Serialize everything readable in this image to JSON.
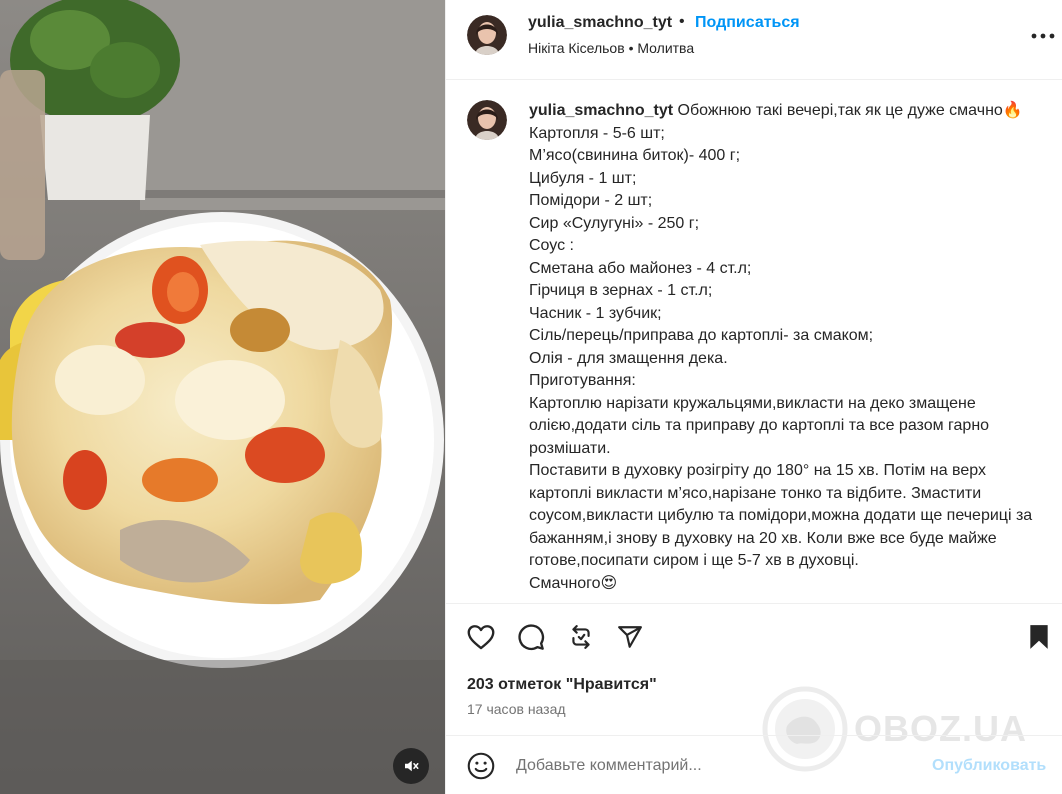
{
  "post": {
    "username": "yulia_smachno_tyt",
    "follow_label": "Подписаться",
    "separator": "•",
    "music_artist": "Нікіта Кісельов",
    "music_track": "Молитва",
    "caption_text": " Обожнюю такі вечері,так як це дуже смачно🔥\nКартопля - 5-6 шт;\nМ’ясо(свинина биток)- 400 г;\nЦибуля - 1 шт;\nПомідори - 2 шт;\nСир «Сулугуні» - 250 г;\nСоус :\nСметана або майонез - 4 ст.л;\nГірчиця в зернах - 1 ст.л;\nЧасник - 1 зубчик;\nСіль/перець/приправа до картоплі- за смаком;\nОлія - для змащення дека.\nПриготування:\nКартоплю нарізати кружальцями,викласти на деко змащене олією,додати сіль та приправу до картоплі та все разом гарно розмішати.\nПоставити в духовку розігріту до 180° на 15 хв. Потім на верх картоплі викласти м’ясо,нарізане тонко та відбите. Змастити соусом,викласти цибулю та помідори,можна додати ще печериці за бажанням,і знову в духовку на 20 хв. Коли вже все буде майже готове,посипати сиром і ще 5-7 хв в духовці.\nСмачного😍",
    "likes_label": "203 отметок \"Нравится\"",
    "time_ago": "17 часов назад"
  },
  "comment": {
    "placeholder": "Добавьте комментарий...",
    "post_label": "Опубликовать"
  },
  "watermark": {
    "text": "OBOZ.UA"
  },
  "icons": {
    "more": "more-options-icon",
    "like": "heart-icon",
    "comment": "comment-icon",
    "repost": "repost-icon",
    "share": "share-icon",
    "save": "bookmark-icon",
    "emoji": "emoji-icon",
    "mute": "muted-speaker-icon"
  },
  "colors": {
    "accent": "#0095f6",
    "post_disabled": "#b2dffc",
    "secondary_text": "#737373"
  }
}
